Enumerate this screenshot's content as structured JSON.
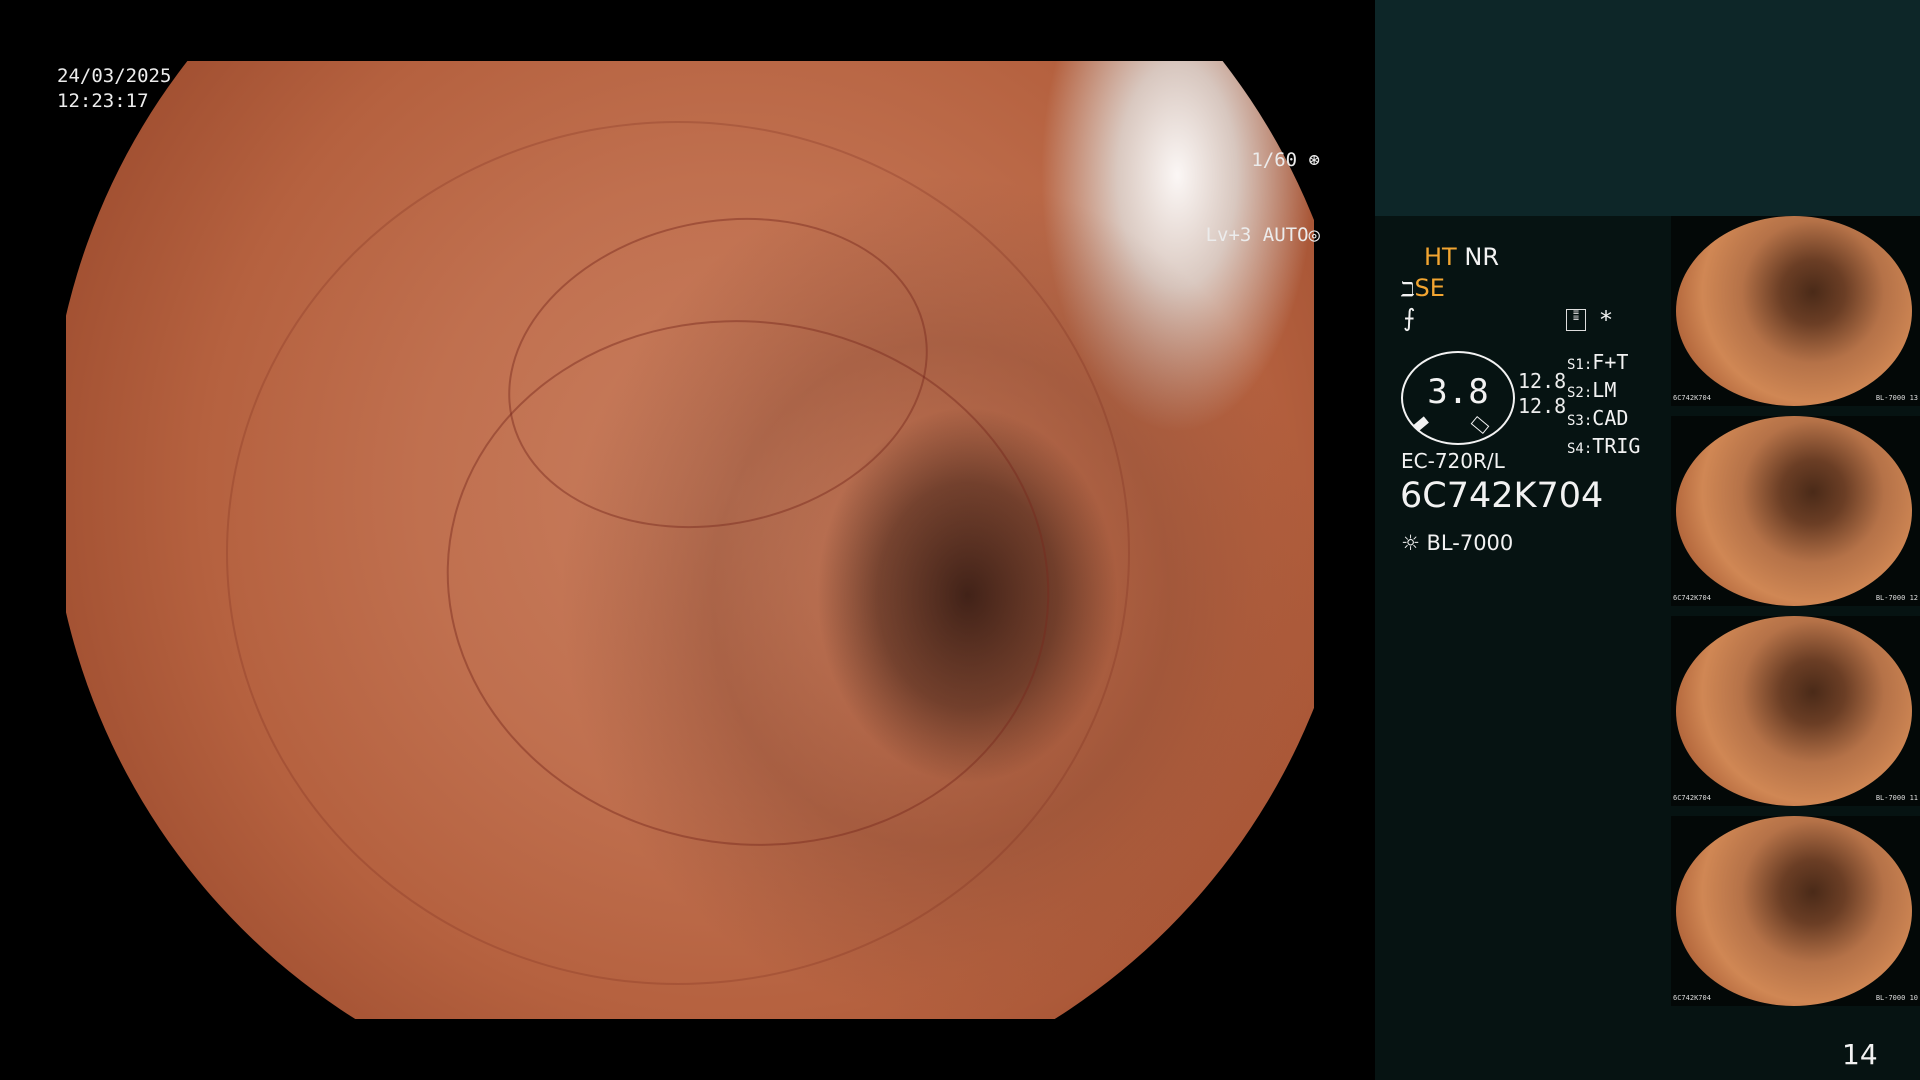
{
  "screen": {
    "date": "24/03/2025",
    "time": "12:23:17",
    "shutter": "1/60",
    "level_mode": "Lv+3 AUTO",
    "page_number": "14"
  },
  "info": {
    "mode_ht": "HT",
    "mode_nr": "NR",
    "mode_se": "SE",
    "gauge_value": "3.8",
    "gauge_readout_1": "12.8",
    "gauge_readout_2": "12.8",
    "star": "*",
    "s1_key": "S1:",
    "s1_val": "F+T",
    "s2_key": "S2:",
    "s2_val": "LM",
    "s3_key": "S3:",
    "s3_val": "CAD",
    "s4_key": "S4:",
    "s4_val": "TRIG",
    "scope_model": "EC-720R/L",
    "serial": "6C742K704",
    "light_source": "BL-7000"
  },
  "thumbnails": [
    {
      "serial": "6C742K704",
      "light": "BL-7000",
      "index": "13"
    },
    {
      "serial": "6C742K704",
      "light": "BL-7000",
      "index": "12"
    },
    {
      "serial": "6C742K704",
      "light": "BL-7000",
      "index": "11"
    },
    {
      "serial": "6C742K704",
      "light": "BL-7000",
      "index": "10"
    }
  ],
  "colors": {
    "accent_amber": "#f2a531",
    "panel_top": "#0d2628",
    "panel_bottom": "#061312"
  }
}
